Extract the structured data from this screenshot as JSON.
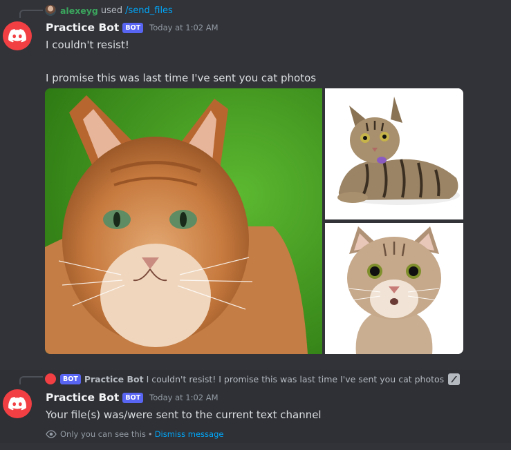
{
  "message1": {
    "reply": {
      "user": "alexeyg",
      "used": "used",
      "command": "/send_files"
    },
    "author": "Practice Bot",
    "bot_tag": "BOT",
    "timestamp": "Today at 1:02 AM",
    "line1": "I couldn't resist!",
    "line2": "I promise this was last time I've sent you cat photos",
    "images": [
      {
        "name": "orange tabby cat on green background"
      },
      {
        "name": "tabby cat lying down"
      },
      {
        "name": "tabby cat sitting facing camera"
      }
    ]
  },
  "message2": {
    "reply": {
      "bot_tag": "BOT",
      "author": "Practice Bot",
      "text": "I couldn't resist!  I promise this was last time I've sent you cat photos"
    },
    "author": "Practice Bot",
    "bot_tag": "BOT",
    "timestamp": "Today at 1:02 AM",
    "text": "Your file(s) was/were sent to the current text channel",
    "ephemeral": {
      "note": "Only you can see this",
      "separator": "•",
      "dismiss": "Dismiss message"
    }
  },
  "colors": {
    "background": "#313338",
    "bot_avatar": "#f23f43",
    "bot_tag": "#5865f2",
    "link": "#00a8fc",
    "username_green": "#3ba55d"
  }
}
